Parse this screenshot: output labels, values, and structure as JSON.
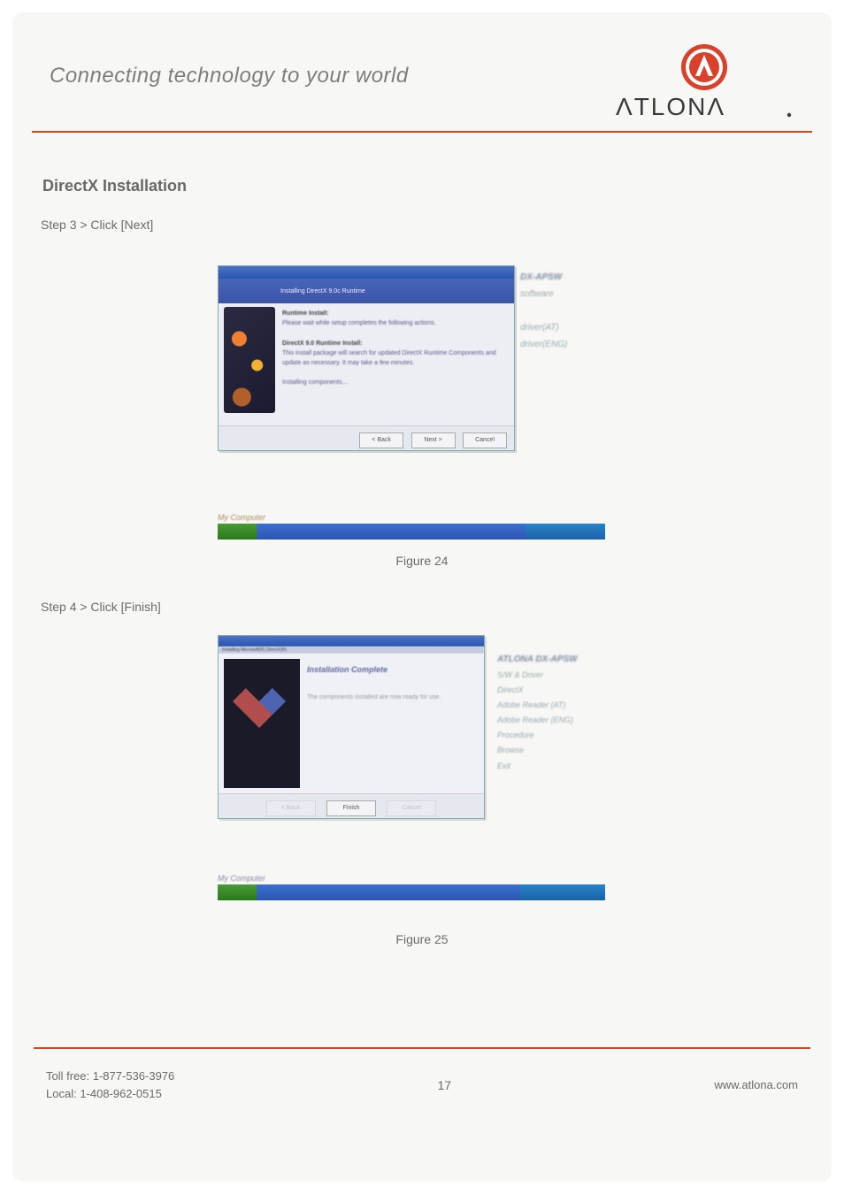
{
  "header": {
    "tagline": "Connecting technology to your world",
    "brand": "ATLONA"
  },
  "section": {
    "title": "DirectX Installation",
    "step3": "Step 3 > Click [Next]",
    "step4": "Step 4 > Click [Finish]"
  },
  "figure1": {
    "caption": "Figure 24",
    "banner_text": "Installing DirectX 9.0c Runtime",
    "content_hdr1": "Runtime Install:",
    "content_line1": "Please wait while setup completes the following actions.",
    "content_hdr2": "DirectX 9.0 Runtime Install:",
    "content_line2a": "This install package will search for updated DirectX Runtime Components and update as necessary. It may take a few minutes.",
    "content_line3": "Installing components…",
    "btn_back": "< Back",
    "btn_next": "Next >",
    "btn_cancel": "Cancel",
    "side_title": "DX-APSW",
    "side_l1": "software",
    "side_l2": "driver(AT)",
    "side_l3": "driver(ENG)",
    "taskbar_label": "My Computer"
  },
  "figure2": {
    "caption": "Figure 25",
    "titlebar": "Installing Microsoft(R) DirectX(R)",
    "content_hdr": "Installation Complete",
    "content_line": "The components installed are now ready for use.",
    "btn_finish": "Finish",
    "side_item1": "ATLONA DX-APSW",
    "side_item2": "S/W & Driver",
    "side_item3": "DirectX",
    "side_item4": "Adobe Reader (AT)",
    "side_item5": "Adobe Reader (ENG)",
    "side_item6": "Procedure",
    "side_item7": "Browse",
    "side_item8": "Exit",
    "taskbar_label": "My Computer"
  },
  "footer": {
    "tollfree_label": "Toll free: ",
    "tollfree": "1-877-536-3976",
    "local_label": "Local: ",
    "local": "1-408-962-0515",
    "page": "17",
    "url": "www.atlona.com"
  }
}
